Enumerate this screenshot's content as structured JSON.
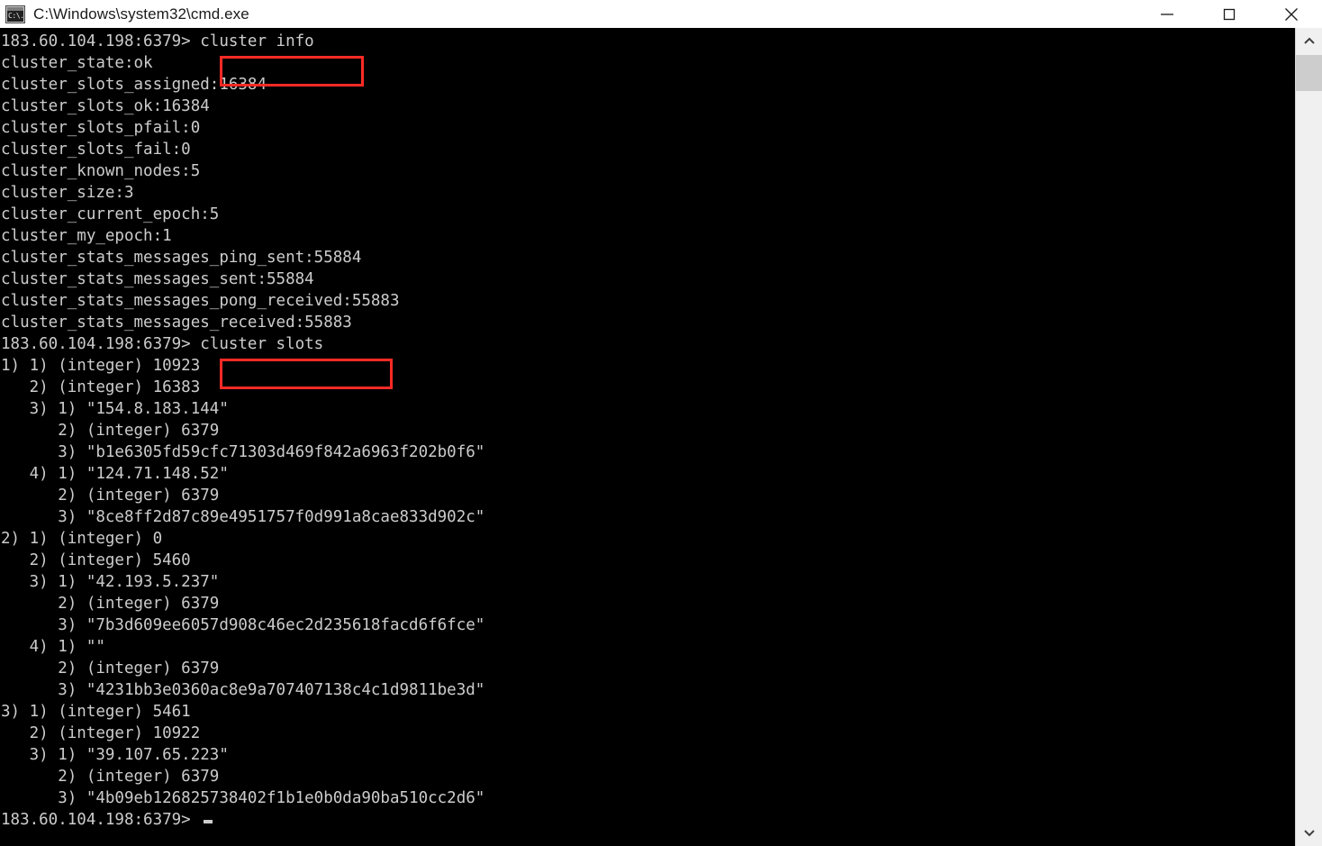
{
  "window": {
    "title": "C:\\Windows\\system32\\cmd.exe",
    "icon": "cmd-console-icon",
    "background_color": "#000000",
    "text_color": "#cccccc",
    "titlebar_color": "#ffffff",
    "annotation_color": "#ff2a26"
  },
  "titlebar_buttons": {
    "minimize": "minimize-icon",
    "maximize": "maximize-icon",
    "close": "close-icon"
  },
  "scrollbar": {
    "up_arrow": "chevron-up-icon",
    "down_arrow": "chevron-down-icon",
    "thumb": "scrollbar-thumb"
  },
  "prompt": "183.60.104.198:6379>",
  "annotations": [
    {
      "name": "cluster-info-command-highlight",
      "text": "cluster info"
    },
    {
      "name": "cluster-slots-command-highlight",
      "text": "cluster slots"
    }
  ],
  "terminal": {
    "lines": [
      "183.60.104.198:6379> cluster info",
      "cluster_state:ok",
      "cluster_slots_assigned:16384",
      "cluster_slots_ok:16384",
      "cluster_slots_pfail:0",
      "cluster_slots_fail:0",
      "cluster_known_nodes:5",
      "cluster_size:3",
      "cluster_current_epoch:5",
      "cluster_my_epoch:1",
      "cluster_stats_messages_ping_sent:55884",
      "cluster_stats_messages_sent:55884",
      "cluster_stats_messages_pong_received:55883",
      "cluster_stats_messages_received:55883",
      "183.60.104.198:6379> cluster slots",
      "1) 1) (integer) 10923",
      "   2) (integer) 16383",
      "   3) 1) \"154.8.183.144\"",
      "      2) (integer) 6379",
      "      3) \"b1e6305fd59cfc71303d469f842a6963f202b0f6\"",
      "   4) 1) \"124.71.148.52\"",
      "      2) (integer) 6379",
      "      3) \"8ce8ff2d87c89e4951757f0d991a8cae833d902c\"",
      "2) 1) (integer) 0",
      "   2) (integer) 5460",
      "   3) 1) \"42.193.5.237\"",
      "      2) (integer) 6379",
      "      3) \"7b3d609ee6057d908c46ec2d235618facd6f6fce\"",
      "   4) 1) \"\"",
      "      2) (integer) 6379",
      "      3) \"4231bb3e0360ac8e9a707407138c4c1d9811be3d\"",
      "3) 1) (integer) 5461",
      "   2) (integer) 10922",
      "   3) 1) \"39.107.65.223\"",
      "      2) (integer) 6379",
      "      3) \"4b09eb126825738402f1b1e0b0da90ba510cc2d6\"",
      "183.60.104.198:6379> "
    ]
  },
  "cluster_info": {
    "cluster_state": "ok",
    "cluster_slots_assigned": "16384",
    "cluster_slots_ok": "16384",
    "cluster_slots_pfail": "0",
    "cluster_slots_fail": "0",
    "cluster_known_nodes": "5",
    "cluster_size": "3",
    "cluster_current_epoch": "5",
    "cluster_my_epoch": "1",
    "cluster_stats_messages_ping_sent": "55884",
    "cluster_stats_messages_sent": "55884",
    "cluster_stats_messages_pong_received": "55883",
    "cluster_stats_messages_received": "55883"
  },
  "cluster_slots": [
    {
      "index": "1)",
      "start_slot": "10923",
      "end_slot": "16383",
      "nodes": [
        {
          "ip": "154.8.183.144",
          "port": "6379",
          "id": "b1e6305fd59cfc71303d469f842a6963f202b0f6"
        },
        {
          "ip": "124.71.148.52",
          "port": "6379",
          "id": "8ce8ff2d87c89e4951757f0d991a8cae833d902c"
        }
      ]
    },
    {
      "index": "2)",
      "start_slot": "0",
      "end_slot": "5460",
      "nodes": [
        {
          "ip": "42.193.5.237",
          "port": "6379",
          "id": "7b3d609ee6057d908c46ec2d235618facd6f6fce"
        },
        {
          "ip": "",
          "port": "6379",
          "id": "4231bb3e0360ac8e9a707407138c4c1d9811be3d"
        }
      ]
    },
    {
      "index": "3)",
      "start_slot": "5461",
      "end_slot": "10922",
      "nodes": [
        {
          "ip": "39.107.65.223",
          "port": "6379",
          "id": "4b09eb126825738402f1b1e0b0da90ba510cc2d6"
        }
      ]
    }
  ]
}
